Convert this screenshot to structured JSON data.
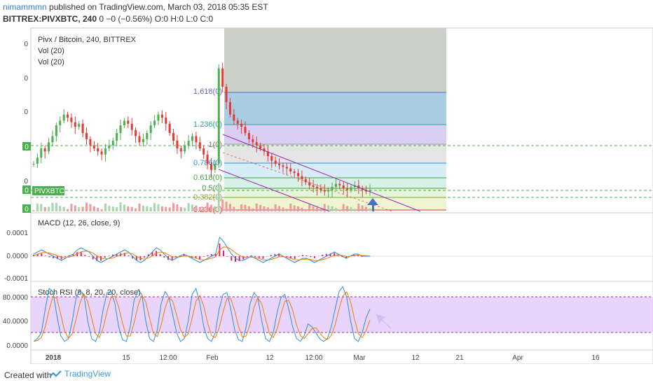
{
  "header": {
    "user": "nimammmn",
    "published": "published on TradingView.com, March 03, 2018 05:35 EST",
    "ticker": "BITTREX:PIVXBTC, 240",
    "ohlc": "0 −0 (−0.56%) O:0 H:0 L:0 C:0"
  },
  "footer": {
    "created": "Created with",
    "brand": "TradingView"
  },
  "colors": {
    "candle_up": "#4caf50",
    "candle_down": "#e53935",
    "macd_line": "#2f8fd8",
    "signal_line": "#f57c00",
    "histogram": "#e91e63",
    "stoch_k": "#2f8fd8",
    "stoch_d": "#f57c00",
    "stoch_band": "#d9b8f5",
    "channel": "#9c27b0",
    "price_label": "#4caf50",
    "arrow": "#4a6fc9"
  },
  "chart_data": [
    {
      "type": "candlestick",
      "title": "Pivx / Bitcoin, 240, BITTREX",
      "legend": [
        "Pivx / Bitcoin, 240, BITTREX",
        "Vol (20)",
        "Vol (20)"
      ],
      "y_tick_labels": [
        "0",
        "0",
        "0",
        "0",
        "0",
        "0",
        "0"
      ],
      "price_tag": "PIVXBTC",
      "fib_levels": [
        {
          "label": "1.618(0)",
          "color": "#5c6bc0"
        },
        {
          "label": "1.236(0)",
          "color": "#26a69a"
        },
        {
          "label": "1(0)",
          "color": "#757575"
        },
        {
          "label": "0.786(0)",
          "color": "#2f8fd8"
        },
        {
          "label": "0.618(0)",
          "color": "#43a047"
        },
        {
          "label": "0.5(0)",
          "color": "#43a047"
        },
        {
          "label": "0.382(0)",
          "color": "#9e9d24"
        },
        {
          "label": "0.236(0)",
          "color": "#e53935"
        }
      ],
      "x_tick_labels": [
        "2018",
        "15",
        "12:00",
        "Feb",
        "12",
        "12:00",
        "Mar",
        "12",
        "21",
        "Apr",
        "16"
      ],
      "price_series_relative": [
        0.3,
        0.34,
        0.4,
        0.38,
        0.44,
        0.48,
        0.55,
        0.58,
        0.62,
        0.6,
        0.57,
        0.54,
        0.56,
        0.5,
        0.46,
        0.42,
        0.4,
        0.38,
        0.36,
        0.4,
        0.42,
        0.45,
        0.5,
        0.55,
        0.58,
        0.56,
        0.52,
        0.48,
        0.44,
        0.46,
        0.5,
        0.55,
        0.58,
        0.62,
        0.6,
        0.56,
        0.5,
        0.45,
        0.4,
        0.38,
        0.42,
        0.45,
        0.48,
        0.44,
        0.4,
        0.36,
        0.3,
        0.26,
        0.3,
        0.92,
        0.8,
        0.7,
        0.62,
        0.58,
        0.56,
        0.54,
        0.5,
        0.46,
        0.44,
        0.42,
        0.4,
        0.38,
        0.35,
        0.32,
        0.3,
        0.29,
        0.28,
        0.27,
        0.25,
        0.24,
        0.22,
        0.2,
        0.18,
        0.16,
        0.15,
        0.14,
        0.13,
        0.12,
        0.13,
        0.15,
        0.17,
        0.16,
        0.14,
        0.13,
        0.15,
        0.16,
        0.14,
        0.13,
        0.12,
        0.13
      ]
    },
    {
      "type": "line",
      "title": "MACD (12, 26, close, 9)",
      "y_tick_labels": [
        "0.0001",
        "0.0000",
        "-0.0001"
      ],
      "series": [
        {
          "name": "MACD"
        },
        {
          "name": "Signal"
        },
        {
          "name": "Histogram"
        }
      ],
      "macd_values": [
        1e-05,
        2e-05,
        3e-05,
        2e-05,
        1e-05,
        0.0,
        -1e-05,
        -2e-05,
        -1e-05,
        0.0,
        1e-05,
        3e-05,
        4e-05,
        3e-05,
        2e-05,
        0.0,
        -2e-05,
        -3e-05,
        -2e-05,
        -1e-05,
        0.0,
        1e-05,
        2e-05,
        3e-05,
        2e-05,
        0.0,
        -2e-05,
        -3e-05,
        -2e-05,
        0.0,
        2e-05,
        4e-05,
        3e-05,
        1e-05,
        -1e-05,
        -2e-05,
        -1e-05,
        0.0,
        1e-05,
        0.0,
        -1e-05,
        -2e-05,
        -3e-05,
        -2e-05,
        -1e-05,
        0.0,
        1e-05,
        9e-05,
        7e-05,
        4e-05,
        1e-05,
        -1e-05,
        -2e-05,
        -2e-05,
        -1e-05,
        0.0,
        -1e-05,
        -2e-05,
        -3e-05,
        -2e-05,
        -1e-05,
        0.0,
        1e-05,
        0.0,
        -1e-05,
        -2e-05,
        -3e-05,
        -2e-05,
        -1e-05,
        -1e-05,
        -2e-05,
        -3e-05,
        -2e-05,
        -1e-05,
        0.0,
        1e-05,
        2e-05,
        1e-05,
        0.0,
        -1e-05,
        0.0,
        1e-05,
        1e-05,
        0.0,
        0.0,
        0.0
      ]
    },
    {
      "type": "line",
      "title": "Stoch RSI (8, 8, 20, 20, close)",
      "y_tick_labels": [
        "80.0000",
        "40.0000",
        "0.0000"
      ],
      "band": [
        20,
        80
      ],
      "series": [
        {
          "name": "K"
        },
        {
          "name": "D"
        }
      ],
      "k_values": [
        5,
        10,
        20,
        60,
        95,
        90,
        50,
        15,
        5,
        10,
        40,
        80,
        92,
        85,
        40,
        10,
        5,
        20,
        60,
        88,
        90,
        70,
        30,
        8,
        5,
        30,
        75,
        92,
        85,
        40,
        10,
        5,
        25,
        70,
        90,
        80,
        50,
        20,
        5,
        10,
        40,
        85,
        95,
        70,
        30,
        10,
        5,
        20,
        60,
        85,
        88,
        60,
        25,
        8,
        5,
        30,
        70,
        88,
        80,
        40,
        10,
        5,
        20,
        55,
        80,
        85,
        60,
        30,
        10,
        5,
        15,
        35,
        30,
        20,
        10,
        5,
        10,
        30,
        60,
        90,
        98,
        80,
        40,
        10,
        5,
        20,
        45,
        60
      ]
    }
  ]
}
